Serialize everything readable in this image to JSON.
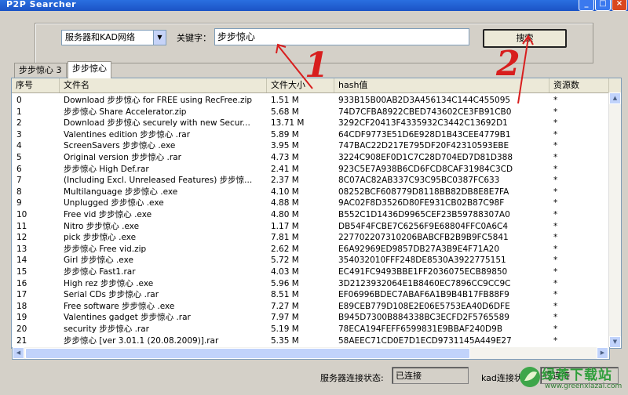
{
  "window": {
    "title": "P2P Searcher"
  },
  "controls": {
    "network_select": "服务器和KAD网络",
    "keyword_label": "关键字：",
    "keyword_value": "步步惊心",
    "search_button": "搜索"
  },
  "tabs": [
    {
      "label": "步步惊心 3"
    },
    {
      "label": "步步惊心"
    }
  ],
  "columns": [
    "序号",
    "文件名",
    "文件大小",
    "hash值",
    "资源数"
  ],
  "rows": [
    [
      "0",
      "Download 步步惊心 for FREE using RecFree.zip",
      "1.51 M",
      "933B15B00AB2D3A456134C144C455095",
      "*"
    ],
    [
      "1",
      "步步惊心 Share Accelerator.zip",
      "5.68 M",
      "74D7CFBA8922CBED743602CE3FB91CB0",
      "*"
    ],
    [
      "2",
      "Download 步步惊心 securely with new Secur...",
      "13.71 M",
      "3292CF20413F4335932C3442C13692D1",
      "*"
    ],
    [
      "3",
      "Valentines edition 步步惊心 .rar",
      "5.89 M",
      "64CDF9773E51D6E928D1B43CEE4779B1",
      "*"
    ],
    [
      "4",
      "ScreenSavers 步步惊心 .exe",
      "3.95 M",
      "747BAC22D217E795DF20F42310593EBE",
      "*"
    ],
    [
      "5",
      "Original version 步步惊心 .rar",
      "4.73 M",
      "3224C908EF0D1C7C28D704ED7D81D388",
      "*"
    ],
    [
      "6",
      "步步惊心  High Def.rar",
      "2.41 M",
      "923C5E7A938B6CD6FCD8CAF31984C3CD",
      "*"
    ],
    [
      "7",
      "(Including Excl. Unreleased Features) 步步惊...",
      "2.37 M",
      "8C07AC82AB337C93C95BC0387FC633",
      "*"
    ],
    [
      "8",
      "Multilanguage 步步惊心 .exe",
      "4.10 M",
      "08252BCF608779D8118BB82DB8E8E7FA",
      "*"
    ],
    [
      "9",
      "Unplugged 步步惊心 .exe",
      "4.88 M",
      "9AC02F8D3526D80FE931CB02B87C98F",
      "*"
    ],
    [
      "10",
      "Free vid 步步惊心 .exe",
      "4.80 M",
      "B552C1D1436D9965CEF23B59788307A0",
      "*"
    ],
    [
      "11",
      "Nitro 步步惊心 .exe",
      "1.17 M",
      "DB54F4FCBE7C6256F9E68804FFC0A6C4",
      "*"
    ],
    [
      "12",
      "pick 步步惊心 .exe",
      "7.81 M",
      "227702207310206BABCFB2B9B9FC5841",
      "*"
    ],
    [
      "13",
      "步步惊心  Free vid.zip",
      "2.62 M",
      "E6A92969ED9857DB27A3B9E4F71A20",
      "*"
    ],
    [
      "14",
      "Girl 步步惊心 .exe",
      "5.72 M",
      "354032010FFF248DE8530A3922775151",
      "*"
    ],
    [
      "15",
      "步步惊心  Fast1.rar",
      "4.03 M",
      "EC491FC9493BBE1FF2036075ECB89850",
      "*"
    ],
    [
      "16",
      "High rez 步步惊心 .exe",
      "5.96 M",
      "3D2123932064E1B8460EC7896CC9CC9C",
      "*"
    ],
    [
      "17",
      "Serial CDs 步步惊心 .rar",
      "8.51 M",
      "EF06996BDEC7ABAF6A1B9B4B17FB88F9",
      "*"
    ],
    [
      "18",
      "Free software 步步惊心 .exe",
      "7.27 M",
      "E89CEB779D108E2E06E5753EA40D6DFE",
      "*"
    ],
    [
      "19",
      "Valentines gadget 步步惊心 .rar",
      "7.97 M",
      "B945D7300B884338BC3ECFD2F5765589",
      "*"
    ],
    [
      "20",
      "security 步步惊心 .rar",
      "5.19 M",
      "78ECA194FEFF6599831E9BBAF240D9B",
      "*"
    ],
    [
      "21",
      "步步惊心 [ver 3.01.1 (20.08.2009)].rar",
      "5.35 M",
      "58AEEC71CD0E7D1ECD9731145A449E27",
      "*"
    ]
  ],
  "status": {
    "server_label": "服务器连接状态:",
    "server_value": "已连接",
    "kad_label": "kad连接状态:",
    "kad_value": "已连接"
  },
  "annotations": {
    "one": "1",
    "two": "2"
  },
  "watermark": {
    "text": "绿茶下载站",
    "url": "www.greenxiazai.com"
  },
  "colors": {
    "annotation": "#d81e1e",
    "titlebar": "#1b53c5",
    "watermark": "#2e9e3a"
  }
}
